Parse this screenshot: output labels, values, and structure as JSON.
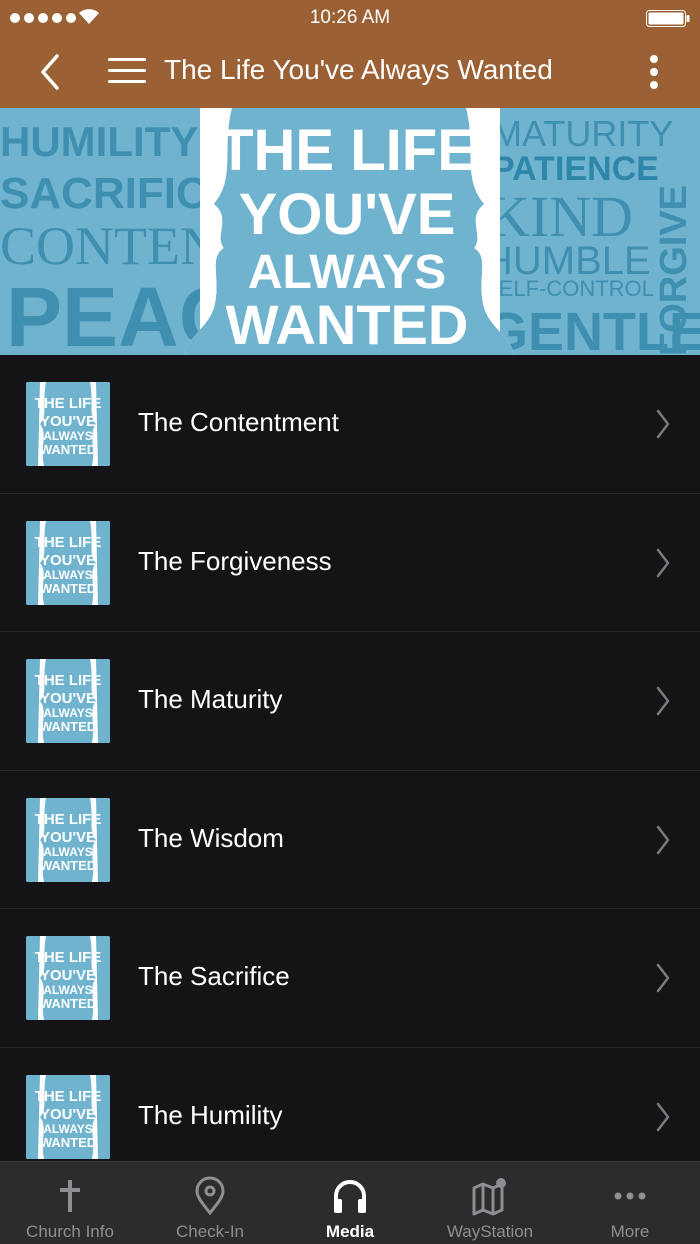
{
  "status_bar": {
    "time": "10:26 AM"
  },
  "nav": {
    "title": "The Life You've Always Wanted"
  },
  "banner": {
    "title_lines": [
      "THE LIFE",
      "YOU'VE",
      "ALWAYS",
      "WANTED"
    ],
    "left_words": [
      "HUMILITY",
      "SACRIFICE",
      "CONTENT",
      "PEACE"
    ],
    "right_words": [
      "MATURITY",
      "PATIENCE",
      "KIND",
      "HUMBLE",
      "SELF-CONTROL",
      "GENTLE",
      "FORGIVE"
    ]
  },
  "thumbnail_text": [
    "THE LIFE",
    "YOU'VE",
    "ALWAYS",
    "WANTED"
  ],
  "items": [
    {
      "label": "The Contentment"
    },
    {
      "label": "The Forgiveness"
    },
    {
      "label": "The Maturity"
    },
    {
      "label": "The Wisdom"
    },
    {
      "label": "The Sacrifice"
    },
    {
      "label": "The Humility"
    }
  ],
  "tabs": [
    {
      "label": "Church Info",
      "icon": "cross-icon"
    },
    {
      "label": "Check-In",
      "icon": "location-pin-icon"
    },
    {
      "label": "Media",
      "icon": "headphones-icon",
      "active": true
    },
    {
      "label": "WayStation",
      "icon": "map-icon"
    },
    {
      "label": "More",
      "icon": "more-dots-icon"
    }
  ],
  "colors": {
    "header": "#9b6034",
    "banner": "#6fb3cf",
    "list_bg": "#141416",
    "tabbar": "#2c2c2f"
  }
}
